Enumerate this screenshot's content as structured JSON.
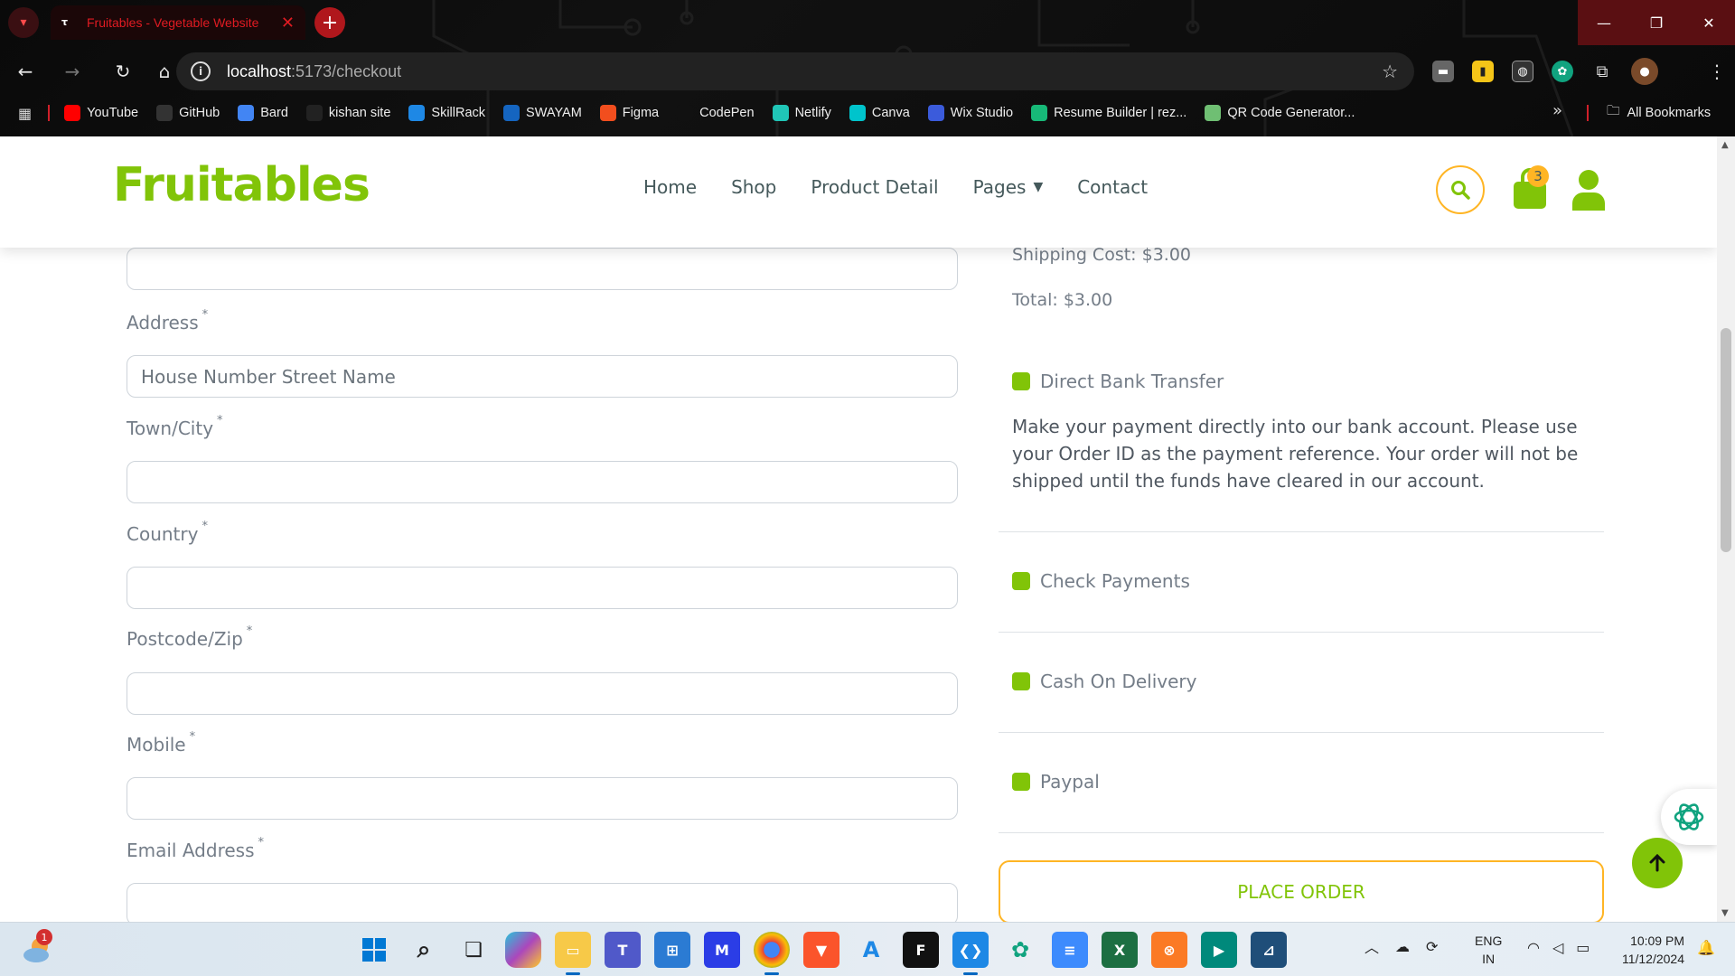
{
  "browser": {
    "tab_title": "Fruitables - Vegetable Website",
    "url_host": "localhost",
    "url_path": ":5173/checkout",
    "bookmarks": [
      {
        "label": "YouTube",
        "icon": "youtube-icon",
        "color": "#ff0000"
      },
      {
        "label": "GitHub",
        "icon": "github-icon",
        "color": "#333333"
      },
      {
        "label": "Bard",
        "icon": "bard-icon",
        "color": "#4285f4"
      },
      {
        "label": "kishan site",
        "icon": "k-icon",
        "color": "#222222"
      },
      {
        "label": "SkillRack",
        "icon": "skillrack-icon",
        "color": "#1e88e5"
      },
      {
        "label": "SWAYAM",
        "icon": "swayam-icon",
        "color": "#1565c0"
      },
      {
        "label": "Figma",
        "icon": "figma-icon",
        "color": "#f24e1e"
      },
      {
        "label": "CodePen",
        "icon": "codepen-icon",
        "color": "#111111"
      },
      {
        "label": "Netlify",
        "icon": "netlify-icon",
        "color": "#20c6b7"
      },
      {
        "label": "Canva",
        "icon": "canva-icon",
        "color": "#00c4cc"
      },
      {
        "label": "Wix Studio",
        "icon": "wix-icon",
        "color": "#3b5bdb"
      },
      {
        "label": "Resume Builder | rez...",
        "icon": "rezi-icon",
        "color": "#17b978"
      },
      {
        "label": "QR Code Generator...",
        "icon": "qr-icon",
        "color": "#6fbf73"
      }
    ],
    "all_bookmarks_label": "All Bookmarks"
  },
  "header": {
    "logo": "Fruitables",
    "nav": [
      {
        "label": "Home"
      },
      {
        "label": "Shop"
      },
      {
        "label": "Product Detail"
      },
      {
        "label": "Pages",
        "has_dropdown": true
      },
      {
        "label": "Contact"
      }
    ],
    "cart_count": "3"
  },
  "form": {
    "top_field_value": "",
    "address_label": "Address",
    "address_placeholder": "House Number Street Name",
    "town_label": "Town/City",
    "country_label": "Country",
    "postcode_label": "Postcode/Zip",
    "mobile_label": "Mobile",
    "email_label": "Email Address",
    "required_mark": "*"
  },
  "summary": {
    "shipping": "Shipping Cost: $3.00",
    "total": "Total: $3.00",
    "payment_methods": [
      {
        "label": "Direct Bank Transfer"
      },
      {
        "label": "Check Payments"
      },
      {
        "label": "Cash On Delivery"
      },
      {
        "label": "Paypal"
      }
    ],
    "bank_description": "Make your payment directly into our bank account. Please use your Order ID as the payment reference. Your order will not be shipped until the funds have cleared in our account.",
    "place_order_label": "Place Order"
  },
  "taskbar": {
    "weather_badge": "1",
    "lang_line1": "ENG",
    "lang_line2": "IN",
    "time": "10:09 PM",
    "date": "11/12/2024"
  },
  "colors": {
    "brand_green": "#81c408",
    "accent_orange": "#ffb524",
    "text_gray": "#747d88"
  }
}
